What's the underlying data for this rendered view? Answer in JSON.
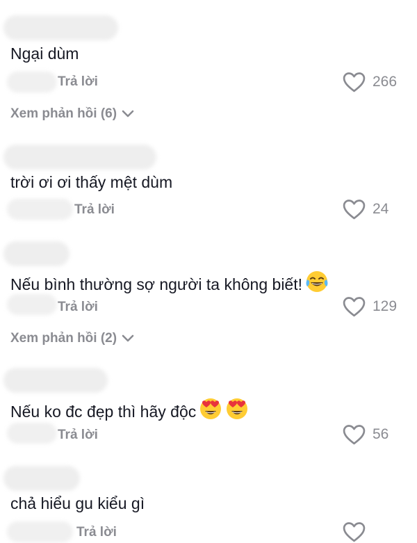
{
  "comments": [
    {
      "text": "Ngại dùm",
      "reply_label": "Trả lời",
      "likes": "266",
      "view_replies": "Xem phản hồi (6)",
      "emojis": []
    },
    {
      "text": "trời ơi ơi thấy mệt dùm",
      "reply_label": "Trả lời",
      "likes": "24",
      "emojis": []
    },
    {
      "text": "Nếu bình thường sợ người ta không biết!",
      "reply_label": "Trả lời",
      "likes": "129",
      "view_replies": "Xem phản hồi (2)",
      "emojis": [
        "face-with-tears-of-joy"
      ]
    },
    {
      "text": "Nếu ko đc đẹp thì hãy độc",
      "reply_label": "Trả lời",
      "likes": "56",
      "emojis": [
        "heart-eyes",
        "heart-eyes"
      ]
    },
    {
      "text": "chả hiểu gu kiểu gì",
      "reply_label": "Trả lời",
      "likes": "",
      "emojis": []
    }
  ],
  "icons": {
    "like": "heart-outline-icon",
    "expand": "chevron-down-icon"
  },
  "colors": {
    "text_primary": "#161823",
    "text_secondary": "#8a8b91",
    "emoji_face": "#ffcc33",
    "emoji_heart": "#e8323c"
  }
}
